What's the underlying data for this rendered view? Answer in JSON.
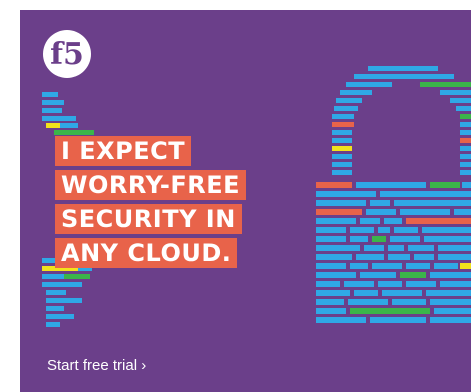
{
  "ad": {
    "headline": {
      "line1": "I EXPECT",
      "line2": "WORRY-FREE",
      "line3": "SECURITY IN",
      "line4": "ANY CLOUD."
    },
    "cta": "Start free trial ›",
    "logo_text": "f5",
    "colors": {
      "background": "#6b3f8a",
      "headline_box": "#e8634a",
      "bar_blue": "#2fa8e6",
      "bar_green": "#3bb54a",
      "bar_yellow": "#f2e21b",
      "bar_coral": "#e8634a"
    },
    "icons": [
      "f5-logo-icon",
      "padlock-illustration"
    ]
  }
}
